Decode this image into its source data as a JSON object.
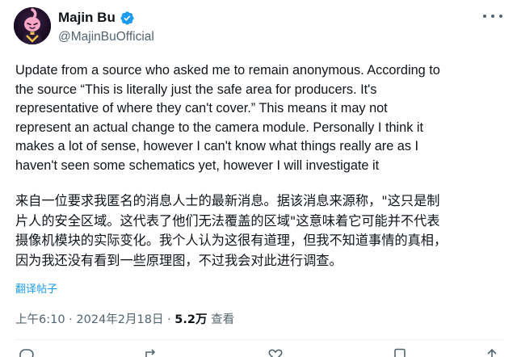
{
  "author": {
    "display_name": "Majin Bu",
    "handle": "@MajinBuOfficial",
    "avatar_icon": "majin-buu-cartoon-avatar",
    "verified_color": "#1d9bf0"
  },
  "post": {
    "text_en_lines": [
      "Update from a source who asked me to remain anonymous. According to",
      "the source “This is literally just the safe area for producers. It's",
      "representative of where they can't cover.” This means it may not",
      "represent an actual change to the camera module. Personally I think it",
      "makes a lot of sense, however I can't know what things really are as I",
      "haven't seen some schematics yet, however I will investigate it"
    ],
    "text_zh_lines": [
      "来自一位要求我匿名的消息人士的最新消息。据该消息来源称，\"这只是制",
      "片人的安全区域。这代表了他们无法覆盖的区域\"这意味着它可能并不代表",
      "摄像机模块的实际变化。我个人认为这很有道理，但我不知道事情的真相，",
      "因为我还没有看到一些原理图，不过我会对此进行调查。"
    ],
    "translate_label": "翻译帖子"
  },
  "meta": {
    "time": "上午6:10",
    "separator": " · ",
    "date": "2024年2月18日",
    "views_count": "5.2万",
    "views_label": " 查看"
  },
  "colors": {
    "text": "#0f1419",
    "secondary": "#536471",
    "accent": "#1d9bf0",
    "divider": "#eff3f4"
  }
}
